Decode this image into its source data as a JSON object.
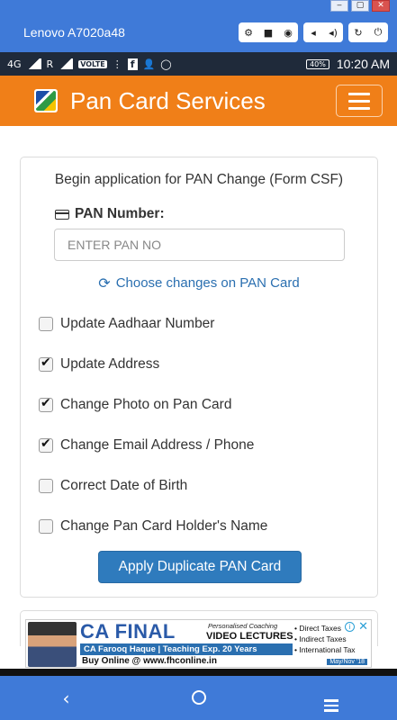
{
  "emulator": {
    "title": "Lenovo A7020a48",
    "window_controls": [
      "‒",
      "▢",
      "✕"
    ],
    "toolbar_icons": [
      "gear-icon",
      "video-icon",
      "camera-icon",
      "volume-down-icon",
      "volume-up-icon",
      "rotate-icon",
      "power-icon"
    ]
  },
  "status_bar": {
    "network": "4G",
    "network2": "R",
    "volte": "VOLTE",
    "battery": "40%",
    "time": "10:20 AM"
  },
  "app": {
    "title": "Pan Card Services"
  },
  "form": {
    "heading": "Begin application for PAN Change (Form CSF)",
    "pan_label": "PAN Number:",
    "pan_placeholder": "ENTER PAN NO",
    "pan_value": "",
    "choose_link": "Choose changes on PAN Card",
    "options": [
      {
        "label": "Update Aadhaar Number",
        "checked": false
      },
      {
        "label": "Update Address",
        "checked": true
      },
      {
        "label": "Change Photo on Pan Card",
        "checked": true
      },
      {
        "label": "Change Email Address / Phone",
        "checked": true
      },
      {
        "label": "Correct Date of Birth",
        "checked": false
      },
      {
        "label": "Change Pan Card Holder's Name",
        "checked": false
      }
    ],
    "apply_button": "Apply Duplicate PAN Card"
  },
  "ad": {
    "title": "CA FINAL",
    "subtitle": "Personalised Coaching",
    "video": "VIDEO LECTURES",
    "teacher": "CA Farooq Haque | Teaching Exp. 20 Years",
    "buy": "Buy Online @ www.fhconline.in",
    "list": [
      "• Direct Taxes",
      "• Indirect Taxes",
      "• International Tax"
    ],
    "date": "May/Nov '18"
  },
  "colors": {
    "header": "#f07f18",
    "emulator": "#3f7ad8",
    "button": "#2f7bbd",
    "link": "#2a6fb0"
  }
}
